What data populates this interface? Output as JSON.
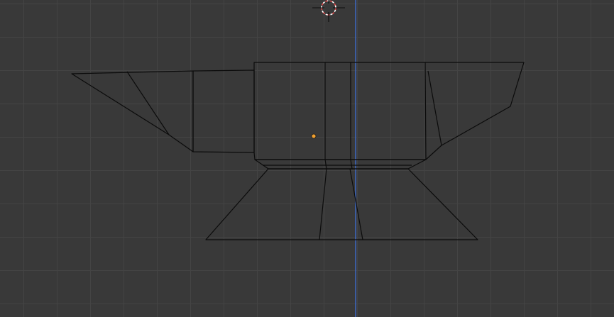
{
  "viewport": {
    "background_color": "#393939",
    "grid_color": "#444444",
    "z_axis_color": "#3f6fd6"
  },
  "scene": {
    "object": "anvil-mesh",
    "display_mode": "wireframe",
    "edge_color": "#0b0b0b",
    "origin_color": "#f0a030",
    "cursor_colors": [
      "#e04848",
      "#ffffff"
    ]
  }
}
